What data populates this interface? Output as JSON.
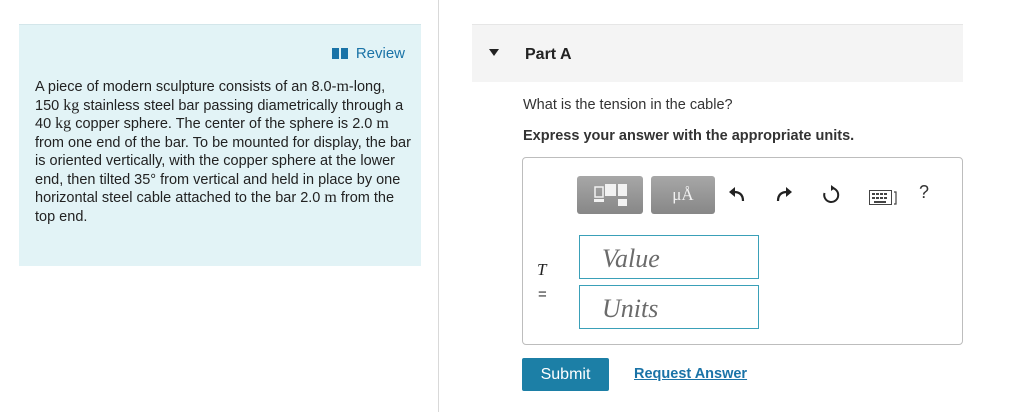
{
  "problem": {
    "review_label": "Review",
    "segments": [
      "A piece of modern sculpture consists of an ",
      "8.0-",
      "m",
      "-long, 150 ",
      "kg",
      " stainless steel bar passing diametrically through a 40 ",
      "kg",
      " copper sphere. The center of the sphere is 2.0 ",
      "m",
      " from one end of the bar. To be mounted for display, the bar is oriented vertically, with the copper sphere at the lower end, then tilted 35° from vertical and held in place by one horizontal steel cable attached to the bar 2.0 ",
      "m",
      " from the top end."
    ]
  },
  "part": {
    "title": "Part A",
    "question": "What is the tension in the cable?",
    "instruction": "Express your answer with the appropriate units."
  },
  "answer": {
    "variable": "T",
    "equals": "=",
    "value_placeholder": "Value",
    "units_placeholder": "Units",
    "mu_label": "μÅ",
    "help_label": "?"
  },
  "actions": {
    "submit_label": "Submit",
    "request_label": "Request Answer"
  },
  "colors": {
    "panel_bg": "#e2f3f6",
    "link": "#1a73a7",
    "submit_bg": "#1c7fa6",
    "field_border": "#3aa0b8"
  },
  "icons": [
    "book-icon",
    "templates-icon",
    "undo-icon",
    "redo-icon",
    "reset-icon",
    "keyboard-icon",
    "caret-down-icon"
  ]
}
